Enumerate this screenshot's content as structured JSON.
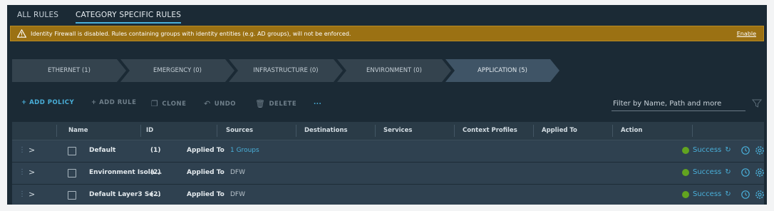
{
  "tabs": [
    {
      "label": "ALL RULES",
      "active": false
    },
    {
      "label": "CATEGORY SPECIFIC RULES",
      "active": true
    }
  ],
  "banner": {
    "icon": "warning-icon",
    "message": "Identity Firewall is disabled. Rules containing groups with identity entities (e.g. AD groups), will not be enforced.",
    "action": "Enable",
    "color": "#9b7113"
  },
  "categories": [
    {
      "label": "ETHERNET (1)",
      "active": false
    },
    {
      "label": "EMERGENCY (0)",
      "active": false
    },
    {
      "label": "INFRASTRUCTURE (0)",
      "active": false
    },
    {
      "label": "ENVIRONMENT (0)",
      "active": false
    },
    {
      "label": "APPLICATION (5)",
      "active": true
    }
  ],
  "toolbar": {
    "add_policy": "+ ADD POLICY",
    "add_rule": "+ ADD RULE",
    "clone": "CLONE",
    "undo": "UNDO",
    "delete": "DELETE",
    "more": "...",
    "filter_placeholder": "Filter by Name, Path and more"
  },
  "table": {
    "columns": [
      "Name",
      "ID",
      "Sources",
      "Destinations",
      "Services",
      "Context Profiles",
      "Applied To",
      "Action"
    ],
    "rows": [
      {
        "name": "Default",
        "id": "(1)",
        "applied_label": "Applied To",
        "applied_value": "1 Groups",
        "applied_link": true,
        "status": "Success"
      },
      {
        "name": "Environment Isola...",
        "id": "(2)",
        "applied_label": "Applied To",
        "applied_value": "DFW",
        "applied_link": false,
        "status": "Success"
      },
      {
        "name": "Default Layer3 Se...",
        "id": "(2)",
        "applied_label": "Applied To",
        "applied_value": "DFW",
        "applied_link": false,
        "status": "Success"
      }
    ]
  },
  "colors": {
    "accent": "#49afd9",
    "success": "#62a420",
    "background": "#1b2a35"
  }
}
